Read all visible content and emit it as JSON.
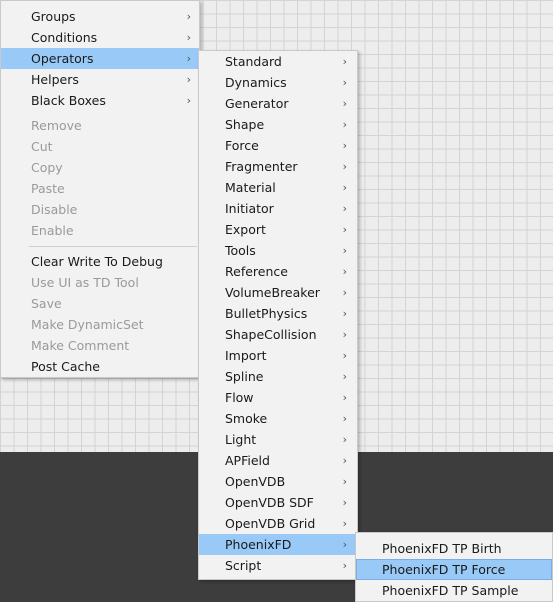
{
  "main_menu": {
    "items": [
      {
        "label": "Groups",
        "arrow": "›",
        "disabled": false
      },
      {
        "label": "Conditions",
        "arrow": "›",
        "disabled": false
      },
      {
        "label": "Operators",
        "arrow": "›",
        "disabled": false,
        "highlight": true
      },
      {
        "label": "Helpers",
        "arrow": "›",
        "disabled": false
      },
      {
        "label": "Black Boxes",
        "arrow": "›",
        "disabled": false
      }
    ],
    "edit_items": [
      {
        "label": "Remove",
        "disabled": true
      },
      {
        "label": "Cut",
        "disabled": true
      },
      {
        "label": "Copy",
        "disabled": true
      },
      {
        "label": "Paste",
        "disabled": true
      },
      {
        "label": "Disable",
        "disabled": true
      },
      {
        "label": "Enable",
        "disabled": true
      }
    ],
    "misc_items": [
      {
        "label": "Clear Write To Debug",
        "disabled": false
      },
      {
        "label": "Use UI as TD Tool",
        "disabled": true
      },
      {
        "label": "Save",
        "disabled": true
      },
      {
        "label": "Make DynamicSet",
        "disabled": true
      },
      {
        "label": "Make Comment",
        "disabled": true
      },
      {
        "label": "Post Cache",
        "disabled": false
      }
    ]
  },
  "operators_menu": {
    "items": [
      {
        "label": "Standard",
        "arrow": "›"
      },
      {
        "label": "Dynamics",
        "arrow": "›"
      },
      {
        "label": "Generator",
        "arrow": "›"
      },
      {
        "label": "Shape",
        "arrow": "›"
      },
      {
        "label": "Force",
        "arrow": "›"
      },
      {
        "label": "Fragmenter",
        "arrow": "›"
      },
      {
        "label": "Material",
        "arrow": "›"
      },
      {
        "label": "Initiator",
        "arrow": "›"
      },
      {
        "label": "Export",
        "arrow": "›"
      },
      {
        "label": "Tools",
        "arrow": "›"
      },
      {
        "label": "Reference",
        "arrow": "›"
      },
      {
        "label": "VolumeBreaker",
        "arrow": "›"
      },
      {
        "label": "BulletPhysics",
        "arrow": "›"
      },
      {
        "label": "ShapeCollision",
        "arrow": "›"
      },
      {
        "label": "Import",
        "arrow": "›"
      },
      {
        "label": "Spline",
        "arrow": "›"
      },
      {
        "label": "Flow",
        "arrow": "›"
      },
      {
        "label": "Smoke",
        "arrow": "›"
      },
      {
        "label": "Light",
        "arrow": "›"
      },
      {
        "label": "APField",
        "arrow": "›"
      },
      {
        "label": "OpenVDB",
        "arrow": "›"
      },
      {
        "label": "OpenVDB SDF",
        "arrow": "›"
      },
      {
        "label": "OpenVDB Grid",
        "arrow": "›"
      },
      {
        "label": "PhoenixFD",
        "arrow": "›",
        "highlight": true
      },
      {
        "label": "Script",
        "arrow": "›"
      }
    ]
  },
  "phoenix_menu": {
    "items": [
      {
        "label": "PhoenixFD TP Birth"
      },
      {
        "label": "PhoenixFD TP Force",
        "selected": true
      },
      {
        "label": "PhoenixFD TP Sample"
      }
    ]
  },
  "colors": {
    "highlight": "#99c9f7",
    "menu_bg": "#f2f2f2",
    "grid_bg": "#ededed",
    "dark_bg": "#3d3d3d"
  }
}
